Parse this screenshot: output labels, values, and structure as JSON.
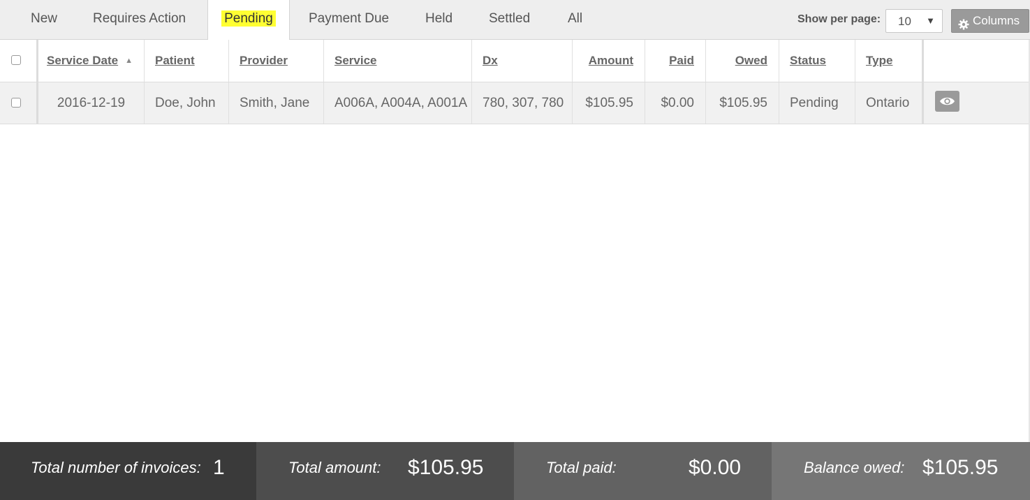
{
  "tabs": [
    {
      "label": "New"
    },
    {
      "label": "Requires Action"
    },
    {
      "label": "Pending",
      "active": true
    },
    {
      "label": "Payment Due"
    },
    {
      "label": "Held"
    },
    {
      "label": "Settled"
    },
    {
      "label": "All"
    }
  ],
  "toolbar": {
    "per_page_label": "Show per page:",
    "per_page_value": "10",
    "columns_label": "Columns"
  },
  "table": {
    "headers": {
      "service_date": "Service Date",
      "patient": "Patient",
      "provider": "Provider",
      "service": "Service",
      "dx": "Dx",
      "amount": "Amount",
      "paid": "Paid",
      "owed": "Owed",
      "status": "Status",
      "type": "Type"
    },
    "sorted_column": "service_date",
    "sort_direction": "ascending",
    "rows": [
      {
        "service_date": "2016-12-19",
        "patient": "Doe, John",
        "provider": "Smith, Jane",
        "service": "A006A, A004A, A001A",
        "dx": "780, 307, 780",
        "amount": "$105.95",
        "paid": "$0.00",
        "owed": "$105.95",
        "status": "Pending",
        "type": "Ontario"
      }
    ]
  },
  "footer": {
    "total_invoices_label": "Total number of invoices:",
    "total_invoices_value": "1",
    "total_amount_label": "Total amount:",
    "total_amount_value": "$105.95",
    "total_paid_label": "Total paid:",
    "total_paid_value": "$0.00",
    "balance_owed_label": "Balance owed:",
    "balance_owed_value": "$105.95"
  },
  "colors": {
    "highlight": "#ffff33",
    "footer_block_1": "#3a3a3a",
    "footer_block_2": "#4d4d4d",
    "footer_block_3": "#626262",
    "footer_block_4": "#767676",
    "button_gray": "#9a9a9a"
  },
  "icons": {
    "sort": "triangle-up-icon",
    "columns": "gear-icon",
    "view": "eye-icon",
    "dropdown": "caret-down-icon"
  }
}
